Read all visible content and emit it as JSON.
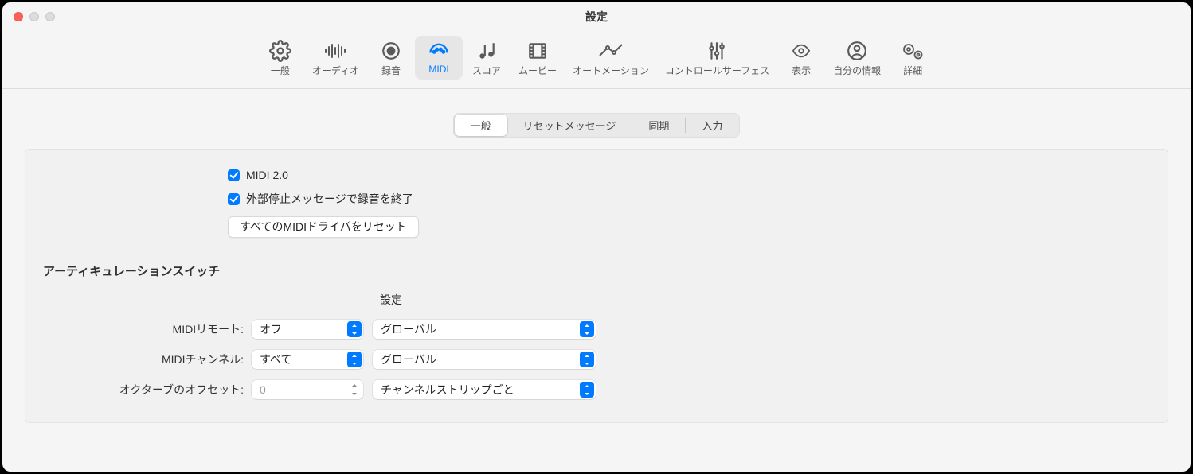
{
  "window": {
    "title": "設定"
  },
  "toolbar": [
    {
      "key": "general",
      "label": "一般"
    },
    {
      "key": "audio",
      "label": "オーディオ"
    },
    {
      "key": "record",
      "label": "録音"
    },
    {
      "key": "midi",
      "label": "MIDI",
      "active": true
    },
    {
      "key": "score",
      "label": "スコア"
    },
    {
      "key": "movie",
      "label": "ムービー"
    },
    {
      "key": "automation",
      "label": "オートメーション"
    },
    {
      "key": "surfaces",
      "label": "コントロールサーフェス"
    },
    {
      "key": "view",
      "label": "表示"
    },
    {
      "key": "myinfo",
      "label": "自分の情報"
    },
    {
      "key": "advanced",
      "label": "詳細"
    }
  ],
  "tabs": {
    "items": [
      "一般",
      "リセットメッセージ",
      "同期",
      "入力"
    ],
    "active": 0
  },
  "options": {
    "midi20_label": "MIDI 2.0",
    "stop_ext_label": "外部停止メッセージで録音を終了",
    "reset_btn": "すべてのMIDIドライバをリセット"
  },
  "articulation": {
    "section_title": "アーティキュレーションスイッチ",
    "col_header": "設定",
    "rows": {
      "remote": {
        "label": "MIDIリモート:",
        "value": "オフ",
        "scope": "グローバル"
      },
      "channel": {
        "label": "MIDIチャンネル:",
        "value": "すべて",
        "scope": "グローバル"
      },
      "octave": {
        "label": "オクターブのオフセット:",
        "value": "0",
        "scope": "チャンネルストリップごと"
      }
    }
  }
}
